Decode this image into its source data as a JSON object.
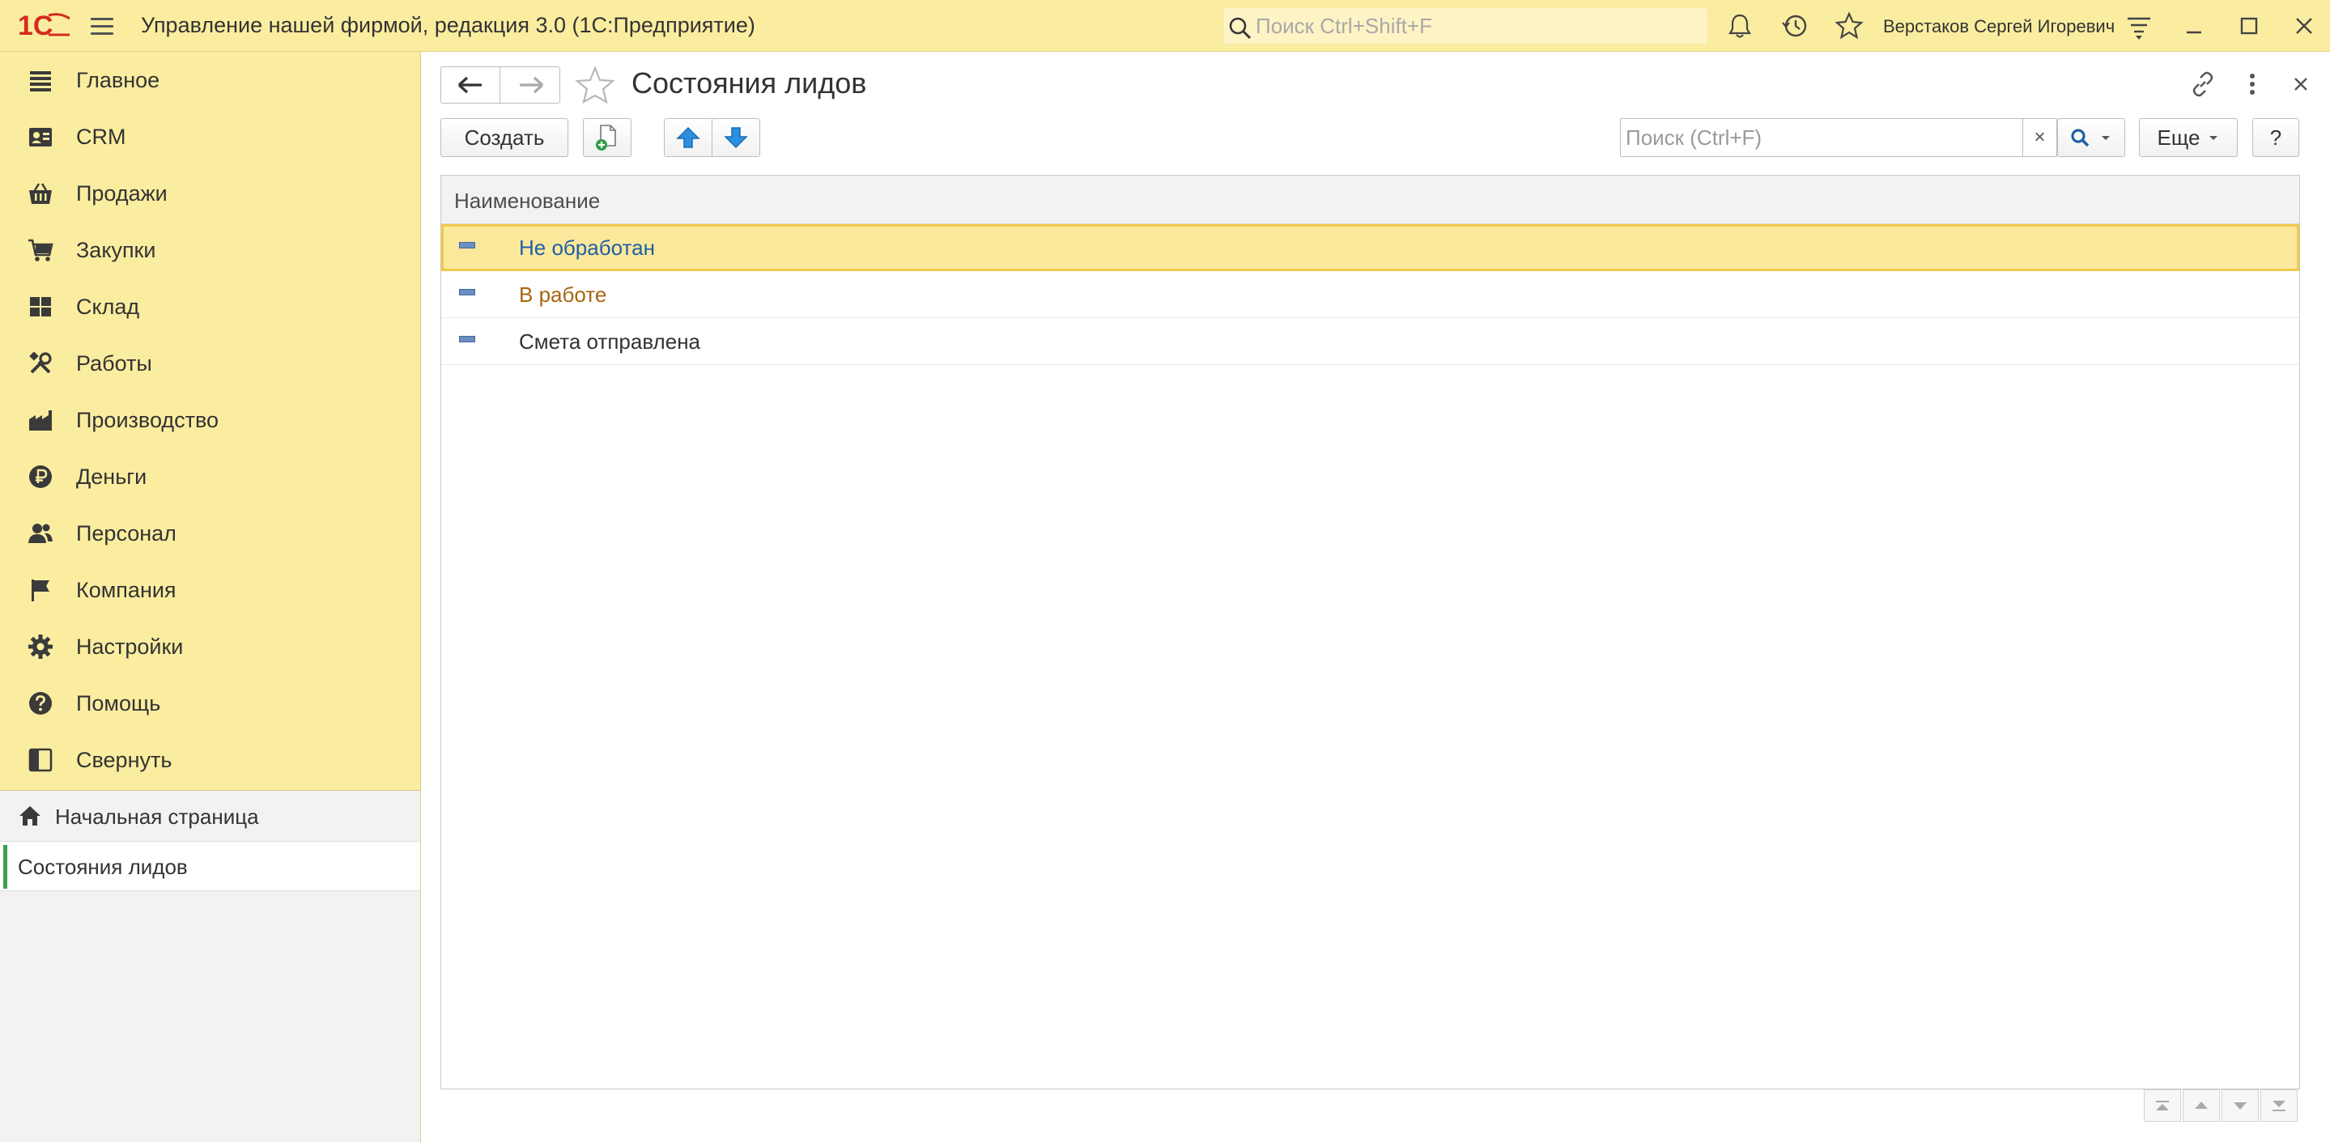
{
  "window": {
    "title": "Управление нашей фирмой, редакция 3.0  (1С:Предприятие)",
    "search_placeholder": "Поиск Ctrl+Shift+F",
    "user_name": "Верстаков Сергей Игоревич"
  },
  "sidebar": {
    "sections": [
      {
        "label": "Главное",
        "icon": "list-icon"
      },
      {
        "label": "CRM",
        "icon": "contact-card-icon"
      },
      {
        "label": "Продажи",
        "icon": "basket-icon"
      },
      {
        "label": "Закупки",
        "icon": "cart-icon"
      },
      {
        "label": "Склад",
        "icon": "warehouse-icon"
      },
      {
        "label": "Работы",
        "icon": "tools-icon"
      },
      {
        "label": "Производство",
        "icon": "factory-icon"
      },
      {
        "label": "Деньги",
        "icon": "ruble-icon"
      },
      {
        "label": "Персонал",
        "icon": "people-icon"
      },
      {
        "label": "Компания",
        "icon": "flag-icon"
      },
      {
        "label": "Настройки",
        "icon": "gear-icon"
      },
      {
        "label": "Помощь",
        "icon": "help-icon"
      },
      {
        "label": "Свернуть",
        "icon": "collapse-panel-icon"
      }
    ],
    "open_windows": {
      "home": "Начальная страница",
      "active": "Состояния лидов"
    }
  },
  "form": {
    "title": "Состояния лидов",
    "toolbar": {
      "create_label": "Создать",
      "search_placeholder": "Поиск (Ctrl+F)",
      "clear_label": "×",
      "more_label": "Еще",
      "help_label": "?"
    },
    "table": {
      "columns": [
        "Наименование"
      ],
      "rows": [
        {
          "name": "Не обработан",
          "color": "#1f5fa5",
          "selected": true
        },
        {
          "name": "В работе",
          "color": "#a86412",
          "selected": false
        },
        {
          "name": "Смета отправлена",
          "color": "#333333",
          "selected": false
        }
      ]
    }
  },
  "colors": {
    "panel_yellow": "#fbeda0",
    "selected_row": "#fbe89b",
    "selected_border": "#f2c94c",
    "active_marker": "#3aa04a",
    "logo_red": "#d52b1e"
  }
}
